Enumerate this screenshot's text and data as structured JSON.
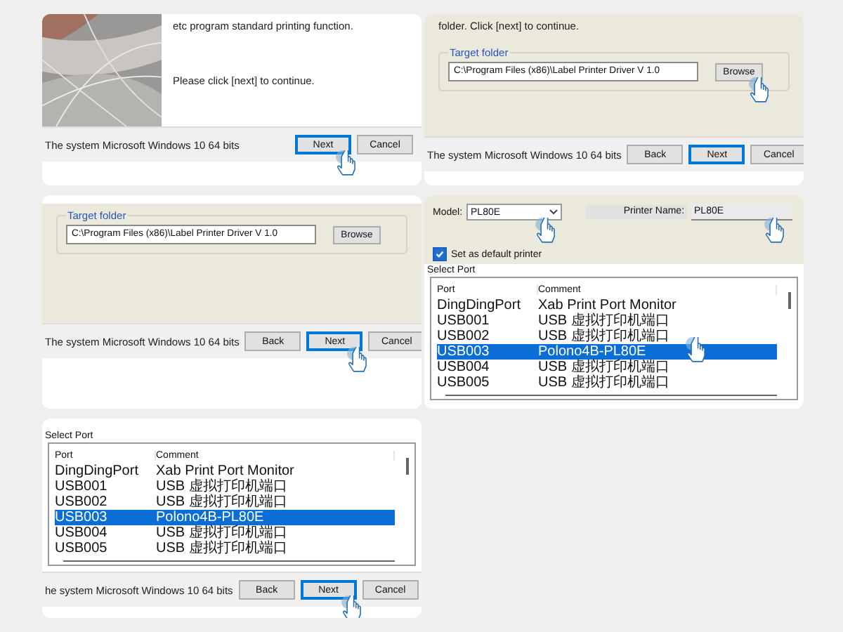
{
  "panels": [
    {
      "kind": "welcome",
      "lines": [
        "etc program standard printing function.",
        "Please click [next] to continue."
      ],
      "status": "The system Microsoft Windows 10 64 bits",
      "buttons": [
        {
          "label": "Next",
          "focused": true,
          "tapped": true
        },
        {
          "label": "Cancel",
          "focused": false,
          "tapped": false
        }
      ]
    },
    {
      "kind": "folder",
      "intro": "folder. Click [next] to continue.",
      "group_label": "Target folder",
      "path": "C:\\Program Files (x86)\\Label Printer Driver V 1.0",
      "browse": {
        "label": "Browse",
        "tapped": true
      },
      "status": "The system Microsoft Windows 10 64 bits",
      "buttons": [
        {
          "label": "Back",
          "focused": false,
          "tapped": false
        },
        {
          "label": "Next",
          "focused": true,
          "tapped": false
        },
        {
          "label": "Cancel",
          "focused": false,
          "tapped": false
        }
      ]
    },
    {
      "kind": "folder",
      "group_label": "Target folder",
      "path": "C:\\Program Files (x86)\\Label Printer Driver V 1.0",
      "browse": {
        "label": "Browse",
        "tapped": false
      },
      "status": "The system Microsoft Windows 10 64 bits",
      "buttons": [
        {
          "label": "Back",
          "focused": false,
          "tapped": false
        },
        {
          "label": "Next",
          "focused": true,
          "tapped": true
        },
        {
          "label": "Cancel",
          "focused": false,
          "tapped": false
        }
      ]
    },
    {
      "kind": "port",
      "model_label": "Model:",
      "model": "PL80E",
      "model_tapped": true,
      "printer_name_label": "Printer Name:",
      "printer_name": "PL80E",
      "printer_name_tapped": true,
      "default_printer": {
        "label": "Set as default printer",
        "checked": true
      },
      "select_port": "Select Port",
      "columns": [
        "Port",
        "Comment"
      ],
      "rows": [
        {
          "port": "DingDingPort",
          "comment": "Xab Print Port Monitor",
          "selected": false,
          "tapped": false
        },
        {
          "port": "USB001",
          "comment": "USB 虚拟打印机端口",
          "selected": false,
          "tapped": false
        },
        {
          "port": "USB002",
          "comment": "USB 虚拟打印机端口",
          "selected": false,
          "tapped": false
        },
        {
          "port": "USB003",
          "comment": "Polono4B-PL80E",
          "selected": true,
          "tapped": true
        },
        {
          "port": "USB004",
          "comment": "USB 虚拟打印机端口",
          "selected": false,
          "tapped": false
        },
        {
          "port": "USB005",
          "comment": "USB 虚拟打印机端口",
          "selected": false,
          "tapped": false
        }
      ]
    },
    {
      "kind": "port_list",
      "select_port": "Select Port",
      "columns": [
        "Port",
        "Comment"
      ],
      "rows": [
        {
          "port": "DingDingPort",
          "comment": "Xab Print Port Monitor",
          "selected": false,
          "tapped": false
        },
        {
          "port": "USB001",
          "comment": "USB 虚拟打印机端口",
          "selected": false,
          "tapped": false
        },
        {
          "port": "USB002",
          "comment": "USB 虚拟打印机端口",
          "selected": false,
          "tapped": false
        },
        {
          "port": "USB003",
          "comment": "Polono4B-PL80E",
          "selected": true,
          "tapped": false
        },
        {
          "port": "USB004",
          "comment": "USB 虚拟打印机端口",
          "selected": false,
          "tapped": false
        },
        {
          "port": "USB005",
          "comment": "USB 虚拟打印机端口",
          "selected": false,
          "tapped": false
        }
      ],
      "status": "he system Microsoft Windows 10 64 bits",
      "buttons": [
        {
          "label": "Back",
          "focused": false,
          "tapped": false
        },
        {
          "label": "Next",
          "focused": true,
          "tapped": true
        },
        {
          "label": "Cancel",
          "focused": false,
          "tapped": false
        }
      ]
    }
  ]
}
